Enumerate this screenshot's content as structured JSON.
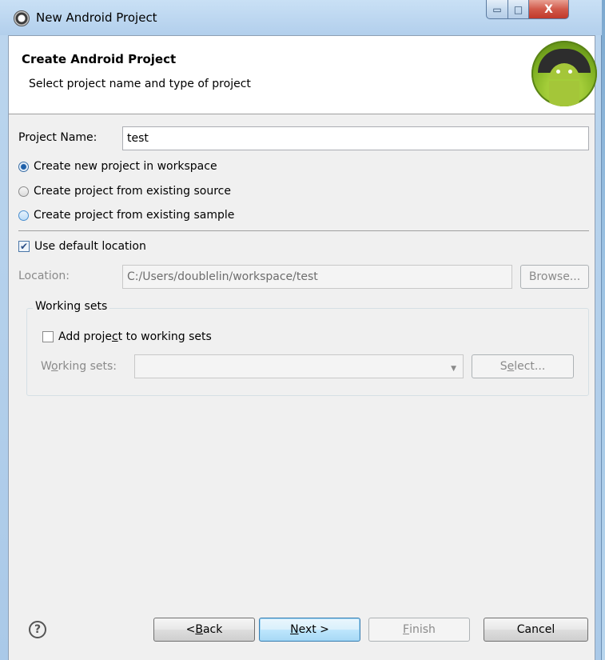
{
  "window": {
    "title": "New Android Project",
    "minimize_glyph": "▭",
    "maximize_glyph": "□",
    "close_glyph": "X"
  },
  "header": {
    "title": "Create Android Project",
    "subtitle": "Select project name and type of project",
    "logo_icon": "android-logo-icon"
  },
  "project_name": {
    "label": "Project Name:",
    "value": "test"
  },
  "project_source": {
    "options": [
      {
        "label": "Create new project in workspace",
        "selected": true
      },
      {
        "label": "Create project from existing source",
        "selected": false
      },
      {
        "label": "Create project from existing sample",
        "selected": false
      }
    ]
  },
  "location": {
    "use_default_label": "Use default location",
    "use_default_checked": true,
    "label": "Location:",
    "value": "C:/Users/doublelin/workspace/test",
    "browse_label": "Browse..."
  },
  "working_sets": {
    "group_label": "Working sets",
    "add_label_pre": "Add proje",
    "add_label_mnemonic": "c",
    "add_label_post": "t to working sets",
    "add_checked": false,
    "combo_label_pre": "W",
    "combo_label_mnemonic": "o",
    "combo_label_post": "rking sets:",
    "combo_value": "",
    "select_pre": "S",
    "select_mnemonic": "e",
    "select_post": "lect..."
  },
  "footer": {
    "help_glyph": "?",
    "back_pre": "< ",
    "back_mnemonic": "B",
    "back_post": "ack",
    "next_mnemonic": "N",
    "next_post": "ext >",
    "finish_mnemonic": "F",
    "finish_post": "inish",
    "cancel_label": "Cancel"
  },
  "colors": {
    "default_button": "#bee6fd",
    "android_green": "#a4c639",
    "titlebar": "#b2cfec"
  }
}
